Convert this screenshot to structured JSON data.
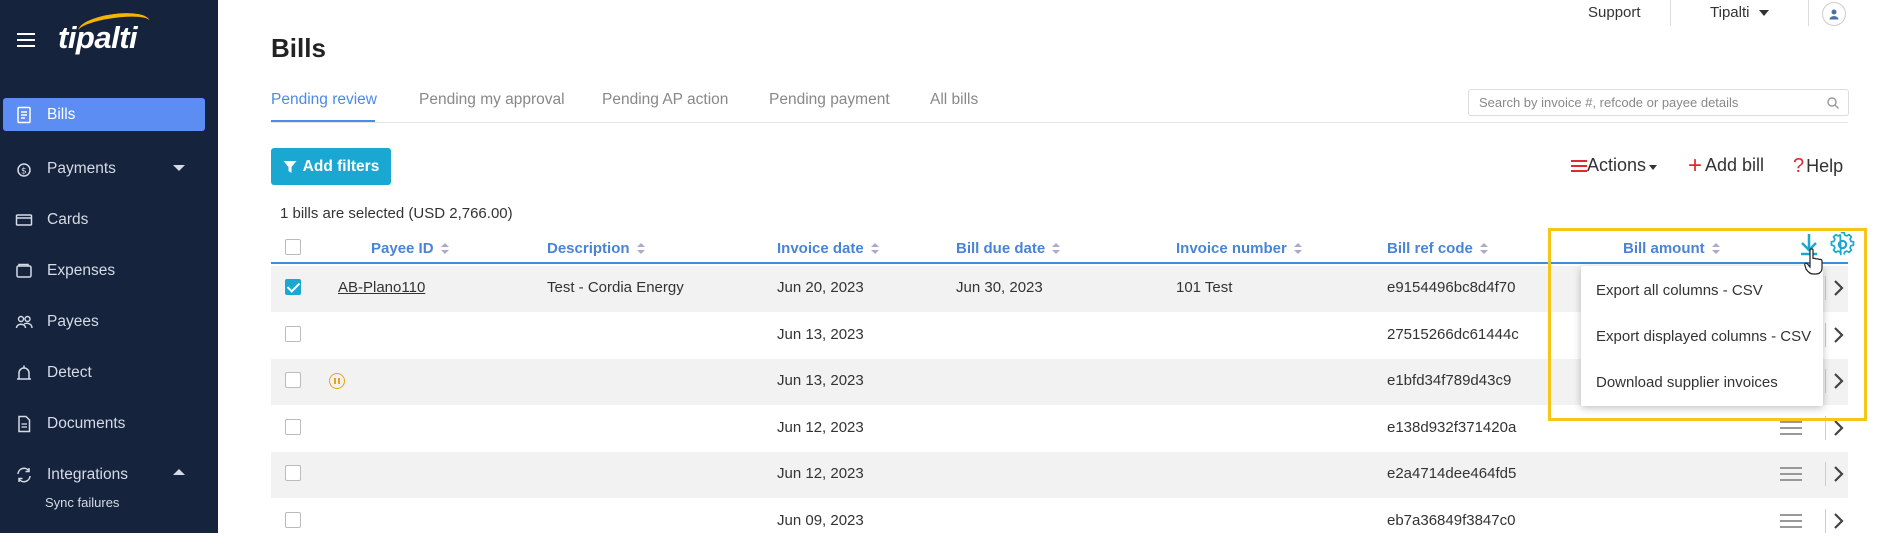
{
  "app": {
    "logo_text": "tipalti"
  },
  "topbar": {
    "support": "Support",
    "company": "Tipalti"
  },
  "sidebar": {
    "items": [
      {
        "label": "Bills",
        "icon": "bills-icon",
        "active": true
      },
      {
        "label": "Payments",
        "icon": "payments-icon",
        "caret": "down"
      },
      {
        "label": "Cards",
        "icon": "card-icon"
      },
      {
        "label": "Expenses",
        "icon": "expenses-icon"
      },
      {
        "label": "Payees",
        "icon": "payees-icon"
      },
      {
        "label": "Detect",
        "icon": "detect-icon"
      },
      {
        "label": "Documents",
        "icon": "documents-icon"
      },
      {
        "label": "Integrations",
        "icon": "integrations-icon",
        "caret": "up"
      }
    ],
    "subitem": "Sync failures"
  },
  "page": {
    "title": "Bills"
  },
  "tabs": [
    "Pending review",
    "Pending my approval",
    "Pending AP action",
    "Pending payment",
    "All bills"
  ],
  "search": {
    "placeholder": "Search by invoice #, refcode or payee details"
  },
  "toolbar": {
    "add_filters": "Add filters",
    "actions": "Actions",
    "add_bill": "Add bill",
    "help": "Help"
  },
  "selection_info": "1 bills are selected (USD 2,766.00)",
  "table": {
    "columns": [
      "Payee ID",
      "Description",
      "Invoice date",
      "Bill due date",
      "Invoice number",
      "Bill ref code",
      "Bill amount"
    ],
    "rows": [
      {
        "checked": true,
        "payee_id": "AB-Plano110",
        "description": "Test - Cordia Energy",
        "invoice_date": "Jun 20, 2023",
        "due_date": "Jun 30, 2023",
        "invoice_number": "101 Test",
        "ref_code": "e9154496bc8d4f70"
      },
      {
        "checked": false,
        "payee_id": "",
        "description": "",
        "invoice_date": "Jun 13, 2023",
        "due_date": "",
        "invoice_number": "",
        "ref_code": "27515266dc61444c"
      },
      {
        "checked": false,
        "payee_id": "",
        "description": "",
        "invoice_date": "Jun 13, 2023",
        "due_date": "",
        "invoice_number": "",
        "ref_code": "e1bfd34f789d43c9",
        "paused": true
      },
      {
        "checked": false,
        "payee_id": "",
        "description": "",
        "invoice_date": "Jun 12, 2023",
        "due_date": "",
        "invoice_number": "",
        "ref_code": "e138d932f371420a"
      },
      {
        "checked": false,
        "payee_id": "",
        "description": "",
        "invoice_date": "Jun 12, 2023",
        "due_date": "",
        "invoice_number": "",
        "ref_code": "e2a4714dee464fd5"
      },
      {
        "checked": false,
        "payee_id": "",
        "description": "",
        "invoice_date": "Jun 09, 2023",
        "due_date": "",
        "invoice_number": "",
        "ref_code": "eb7a36849f3847c0"
      }
    ]
  },
  "export_menu": {
    "items": [
      "Export all columns - CSV",
      "Export displayed columns - CSV",
      "Download supplier invoices"
    ]
  },
  "colors": {
    "sidebar_bg": "#16233d",
    "accent": "#1aa8d3",
    "active_nav": "#5c8df2",
    "link_blue": "#4a84d6",
    "highlight": "#f5c518",
    "red": "#e0282e"
  }
}
